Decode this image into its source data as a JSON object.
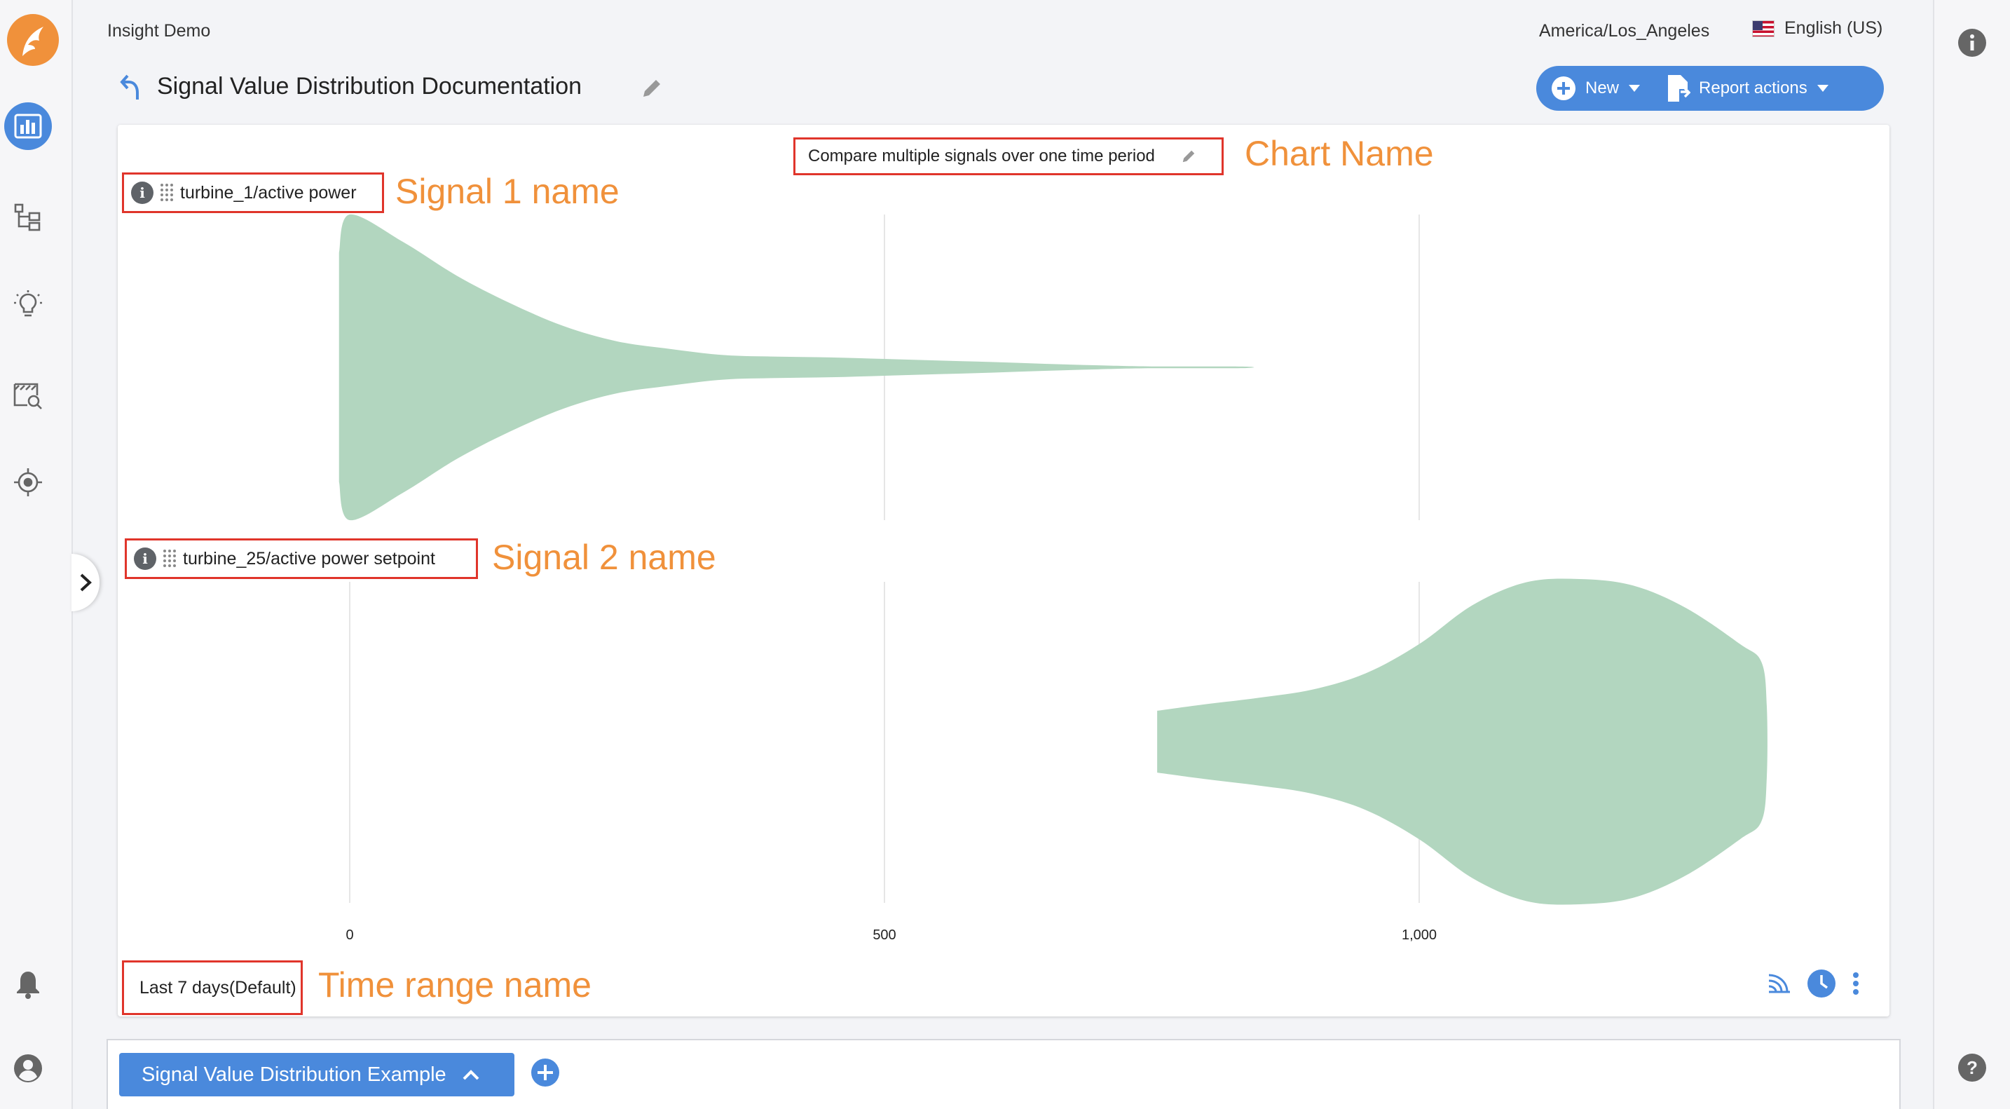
{
  "header": {
    "workbook_name": "Insight Demo",
    "timezone": "America/Los_Angeles",
    "language": "English (US)"
  },
  "page": {
    "title": "Signal Value Distribution Documentation"
  },
  "actions": {
    "new_label": "New",
    "report_actions_label": "Report actions"
  },
  "chart": {
    "name": "Compare multiple signals over one time period",
    "time_range": "Last 7 days(Default)"
  },
  "annotations": {
    "chart_name": "Chart Name",
    "signal_1": "Signal 1 name",
    "signal_2": "Signal 2 name",
    "time_range": "Time range name"
  },
  "worksheet": {
    "tab_label": "Signal Value Distribution Example"
  },
  "colors": {
    "accent": "#4a89dc",
    "brand": "#f0913b",
    "violin_fill": "#b2d6bf",
    "annotation_box": "#e0352b"
  },
  "chart_data": {
    "type": "violin",
    "x_ticks": [
      0,
      500,
      1000
    ],
    "x_tick_labels": [
      "0",
      "500",
      "1,000"
    ],
    "xlim": [
      -250,
      1450
    ],
    "series": [
      {
        "name": "turbine_1/active power",
        "profile": [
          [
            -10,
            0.75
          ],
          [
            0,
            1.0
          ],
          [
            50,
            0.82
          ],
          [
            100,
            0.6
          ],
          [
            150,
            0.42
          ],
          [
            200,
            0.27
          ],
          [
            250,
            0.17
          ],
          [
            300,
            0.12
          ],
          [
            350,
            0.08
          ],
          [
            400,
            0.07
          ],
          [
            450,
            0.065
          ],
          [
            500,
            0.055
          ],
          [
            550,
            0.045
          ],
          [
            600,
            0.035
          ],
          [
            650,
            0.023
          ],
          [
            700,
            0.013
          ],
          [
            750,
            0.006
          ],
          [
            835,
            0.005
          ]
        ]
      },
      {
        "name": "turbine_25/active power setpoint",
        "profile": [
          [
            755,
            0.19
          ],
          [
            800,
            0.23
          ],
          [
            850,
            0.27
          ],
          [
            900,
            0.32
          ],
          [
            950,
            0.42
          ],
          [
            1000,
            0.6
          ],
          [
            1050,
            0.84
          ],
          [
            1100,
            0.98
          ],
          [
            1150,
            1.0
          ],
          [
            1200,
            0.96
          ],
          [
            1250,
            0.82
          ],
          [
            1300,
            0.6
          ],
          [
            1320,
            0.49
          ],
          [
            1325,
            0.22
          ]
        ]
      }
    ]
  }
}
